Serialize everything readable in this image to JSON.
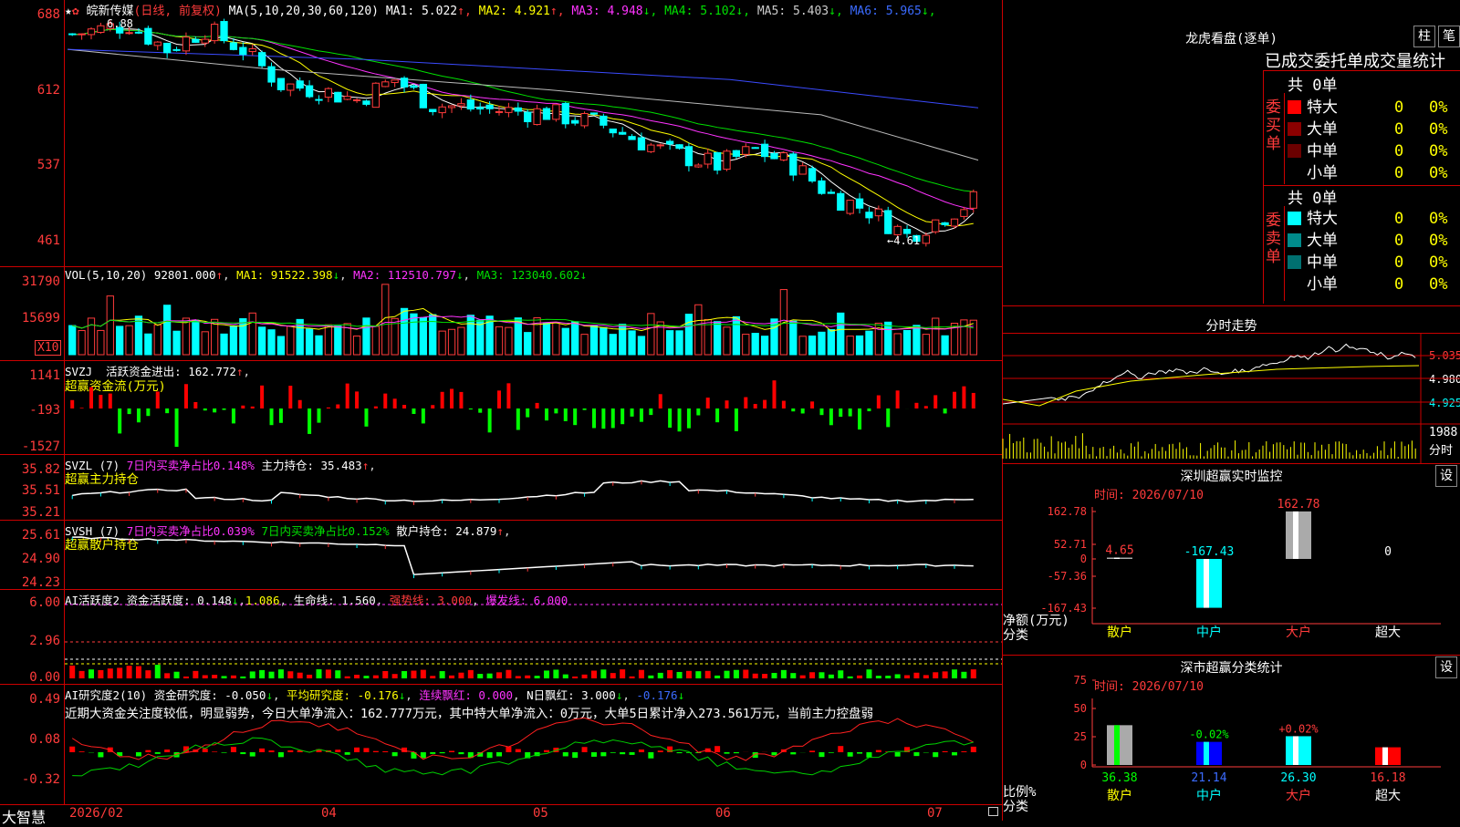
{
  "main": {
    "stock": "皖新传媒",
    "mode": "(日线, 前复权)",
    "ma_label": "MA(5,10,20,30,60,120)",
    "ma": [
      {
        "name": "MA1: 5.022",
        "arrow": "↑",
        "color": "#ffffff"
      },
      {
        "name": "MA2: 4.921",
        "arrow": "↑",
        "color": "#ffff00"
      },
      {
        "name": "MA3: 4.948",
        "arrow": "↓",
        "color": "#ff33ff"
      },
      {
        "name": "MA4: 5.102",
        "arrow": "↓",
        "color": "#00e000"
      },
      {
        "name": "MA5: 5.403",
        "arrow": "↓",
        "color": "#cccccc"
      },
      {
        "name": "MA6: 5.965",
        "arrow": "↓",
        "color": "#3b6bff"
      }
    ],
    "yticks": [
      "688",
      "612",
      "537",
      "461"
    ],
    "high_label": "6.88",
    "low_label": "←4.61"
  },
  "vol": {
    "label": "VOL(5,10,20)",
    "value": "92801.000",
    "arrow": "↑",
    "ma1": "MA1: 91522.398",
    "ma1a": "↓",
    "ma2": "MA2: 112510.797",
    "ma2a": "↓",
    "ma3": "MA3: 123040.602",
    "ma3a": "↓",
    "yticks": [
      "31790",
      "15699"
    ],
    "unit": "X10"
  },
  "svzj": {
    "label": "SVZJ",
    "desc": "活跃资金进出: 162.772",
    "arrow": "↑",
    "sub": "超赢资金流(万元)",
    "yticks": [
      "1141",
      "-193",
      "-1527"
    ]
  },
  "svzl": {
    "label": "SVZL (7)",
    "p1": "7日内买卖净占比0.148%",
    "p2": "主力持仓: 35.483",
    "arrow": "↑",
    "sub": "超赢主力持仓",
    "yticks": [
      "35.82",
      "35.51",
      "35.21"
    ]
  },
  "svsh": {
    "label": "SVSH (7)",
    "p1": "7日内买卖净占比0.039%",
    "p2": "7日内买卖净占比0.152%",
    "p3": "散户持仓: 24.879",
    "arrow": "↑",
    "sub": "超赢散户持仓",
    "yticks": [
      "25.61",
      "24.90",
      "24.23"
    ]
  },
  "ai1": {
    "label": "AI活跃度2",
    "p1": "资金活跃度: 0.148",
    "a1": "↓",
    "p2": "1.086",
    "p3": "生命线: 1.560",
    "p4": "强势线: 3.000",
    "p5": "爆发线: 6.000",
    "yticks": [
      "6.00",
      "2.96",
      "0.00"
    ]
  },
  "ai2": {
    "label": "AI研究度2(10)",
    "p1": "资金研究度: -0.050",
    "a1": "↓",
    "p2": "平均研究度: -0.176",
    "a2": "↓",
    "p3": "连续飘红: 0.000",
    "p4": "N日飘红: 3.000",
    "a4": "↓",
    "p5": "-0.176",
    "a5": "↓",
    "comment": "近期大资金关注度较低，明显弱势，今日大单净流入：162.777万元，其中特大单净流入：0万元，大单5日累计净入273.561万元，当前主力控盘弱",
    "yticks": [
      "0.49",
      "0.08",
      "-0.32"
    ]
  },
  "bottom": {
    "brand": "大智慧",
    "dates": [
      "2026/02",
      "04",
      "05",
      "06",
      "07"
    ]
  },
  "lhb": {
    "title": "龙虎看盘(逐单)",
    "btn1": "柱",
    "btn2": "笔",
    "heading": "已成交委托单成交量统计",
    "buy_side": "委买单",
    "sell_side": "委卖单",
    "buy_total": "共 0单",
    "sell_total": "共 0单",
    "rows": [
      {
        "name": "特大",
        "val": "0",
        "pct": "0%"
      },
      {
        "name": "大单",
        "val": "0",
        "pct": "0%"
      },
      {
        "name": "中单",
        "val": "0",
        "pct": "0%"
      },
      {
        "name": "小单",
        "val": "0",
        "pct": "0%"
      }
    ],
    "buy_colors": [
      "#ff0000",
      "#8b0000",
      "#6b0000",
      ""
    ],
    "sell_colors": [
      "#00ffff",
      "#008b8b",
      "#007070",
      ""
    ]
  },
  "fenshi": {
    "title": "分时走势",
    "yticks": [
      "5.035",
      "4.980",
      "4.925"
    ],
    "vol_tick": "1988",
    "vol_unit": "分时"
  },
  "szmon": {
    "title": "深圳超赢实时监控",
    "btn": "设",
    "time": "时间: 2026/07/10",
    "yticks": [
      "162.78",
      "52.71",
      "0",
      "-57.36",
      "-167.43"
    ],
    "ylabel": "净额(万元)",
    "xlabel": "分类",
    "chart_data": {
      "type": "bar",
      "categories": [
        "散户",
        "中户",
        "大户",
        "超大"
      ],
      "values": [
        4.65,
        -167.43,
        162.78,
        0
      ],
      "labels": [
        "4.65",
        "-167.43",
        "162.78",
        "0"
      ],
      "ylim": [
        -167.43,
        162.78
      ]
    }
  },
  "szcls": {
    "title": "深市超赢分类统计",
    "btn": "设",
    "time": "时间: 2026/07/10",
    "yticks": [
      "75",
      "50",
      "25",
      "0"
    ],
    "ylabel": "比例%",
    "xlabel": "分类",
    "chart_data": {
      "type": "bar",
      "categories": [
        "散户",
        "中户",
        "大户",
        "超大"
      ],
      "values": [
        36.38,
        21.14,
        26.3,
        16.18
      ],
      "labels": [
        "36.38",
        "21.14",
        "26.30",
        "16.18"
      ],
      "changes": [
        "",
        "-0.02%",
        "+0.02%",
        ""
      ],
      "ylim": [
        0,
        75
      ]
    }
  },
  "chart_data": [
    {
      "type": "candlestick",
      "title": "皖新传媒 (日线, 前复权)",
      "ylim": [
        4.45,
        6.95
      ],
      "ticks": [
        "688",
        "612",
        "537",
        "461"
      ],
      "high": 6.88,
      "low": 4.61
    },
    {
      "type": "bar",
      "title": "深圳超赢实时监控",
      "categories": [
        "散户",
        "中户",
        "大户",
        "超大"
      ],
      "values": [
        4.65,
        -167.43,
        162.78,
        0
      ]
    },
    {
      "type": "bar",
      "title": "深市超赢分类统计",
      "categories": [
        "散户",
        "中户",
        "大户",
        "超大"
      ],
      "values": [
        36.38,
        21.14,
        26.3,
        16.18
      ]
    }
  ]
}
